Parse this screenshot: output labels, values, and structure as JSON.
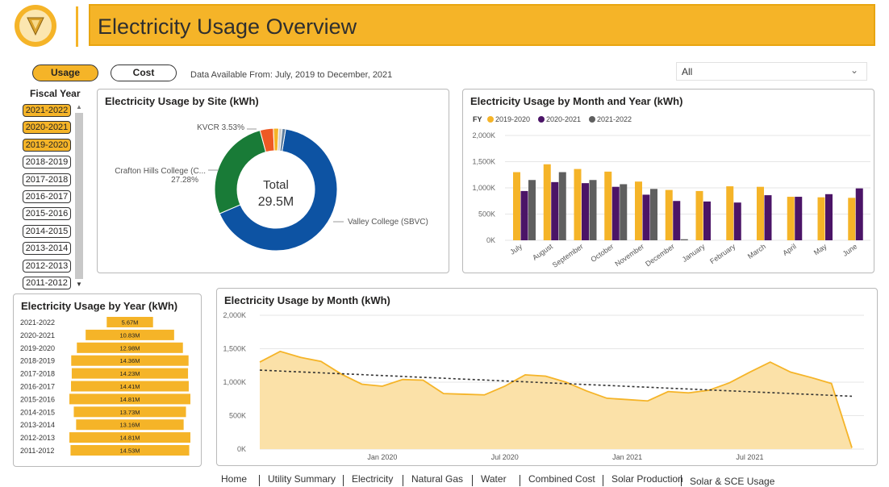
{
  "header": {
    "title": "Electricity Usage Overview"
  },
  "toggles": {
    "usage": "Usage",
    "cost": "Cost"
  },
  "availability": "Data Available From: July, 2019 to December, 2021",
  "site_filter": {
    "value": "All"
  },
  "fiscal_year": {
    "title": "Fiscal Year",
    "items": [
      {
        "label": "2021-2022",
        "selected": true
      },
      {
        "label": "2020-2021",
        "selected": true
      },
      {
        "label": "2019-2020",
        "selected": true
      },
      {
        "label": "2018-2019",
        "selected": false
      },
      {
        "label": "2017-2018",
        "selected": false
      },
      {
        "label": "2016-2017",
        "selected": false
      },
      {
        "label": "2015-2016",
        "selected": false
      },
      {
        "label": "2014-2015",
        "selected": false
      },
      {
        "label": "2013-2014",
        "selected": false
      },
      {
        "label": "2012-2013",
        "selected": false
      },
      {
        "label": "2011-2012",
        "selected": false
      }
    ]
  },
  "colors": {
    "accent": "#f5b428",
    "y2020_2021": "#4b1467",
    "y2021_2022": "#5f5f5f",
    "valley": "#0d53a3",
    "crafton": "#197b37",
    "kvcr": "#ee5a24"
  },
  "nav": [
    "Home",
    "Utility Summary",
    "Electricity",
    "Natural Gas",
    "Water",
    "Combined Cost",
    "Solar Production",
    "Solar & SCE Usage"
  ],
  "chart_data": [
    {
      "type": "pie",
      "title": "Electricity Usage by Site (kWh)",
      "center_label": "Total",
      "center_value": "29.5M",
      "slices": [
        {
          "name": "Valley College (SBVC)",
          "value": 66.0,
          "color": "#0d53a3",
          "label": "Valley College (SBVC)"
        },
        {
          "name": "Crafton Hills College",
          "value": 27.28,
          "color": "#197b37",
          "label": "Crafton Hills College (C...",
          "sublabel": "27.28%"
        },
        {
          "name": "KVCR",
          "value": 3.53,
          "color": "#ee5a24",
          "label": "KVCR 3.53%"
        },
        {
          "name": "other-1",
          "value": 1.4,
          "color": "#f5b428"
        },
        {
          "name": "other-2",
          "value": 0.9,
          "color": "#cfcfcf"
        },
        {
          "name": "other-3",
          "value": 0.9,
          "color": "#5f7fa0"
        }
      ]
    },
    {
      "type": "bar",
      "title": "Electricity Usage by Month and Year (kWh)",
      "legend_title": "FY",
      "categories": [
        "July",
        "August",
        "September",
        "October",
        "November",
        "December",
        "January",
        "February",
        "March",
        "April",
        "May",
        "June"
      ],
      "series": [
        {
          "name": "2019-2020",
          "color": "#f5b428",
          "values": [
            1300000,
            1450000,
            1360000,
            1310000,
            1120000,
            960000,
            940000,
            1030000,
            1020000,
            830000,
            820000,
            810000
          ]
        },
        {
          "name": "2020-2021",
          "color": "#4b1467",
          "values": [
            940000,
            1110000,
            1090000,
            1020000,
            870000,
            750000,
            740000,
            720000,
            860000,
            830000,
            880000,
            990000
          ]
        },
        {
          "name": "2021-2022",
          "color": "#5f5f5f",
          "values": [
            1150000,
            1300000,
            1150000,
            1070000,
            980000,
            20000,
            null,
            null,
            null,
            null,
            null,
            null
          ]
        }
      ],
      "ylim": [
        0,
        2000000
      ],
      "yticks": [
        "0K",
        "500K",
        "1,000K",
        "1,500K",
        "2,000K"
      ],
      "legend_position": "top-left"
    },
    {
      "type": "bar",
      "title": "Electricity Usage by Year (kWh)",
      "categories": [
        "2021-2022",
        "2020-2021",
        "2019-2020",
        "2018-2019",
        "2017-2018",
        "2016-2017",
        "2015-2016",
        "2014-2015",
        "2013-2014",
        "2012-2013",
        "2011-2012"
      ],
      "values": [
        5.67,
        10.83,
        12.98,
        14.36,
        14.23,
        14.41,
        14.81,
        13.73,
        13.16,
        14.81,
        14.53
      ],
      "data_labels": [
        "5.67M",
        "10.83M",
        "12.98M",
        "14.36M",
        "14.23M",
        "14.41M",
        "14.81M",
        "13.73M",
        "13.16M",
        "14.81M",
        "14.53M"
      ],
      "orientation": "horizontal-centered"
    },
    {
      "type": "area",
      "title": "Electricity Usage by Month (kWh)",
      "x": [
        "Jul 2019",
        "Aug 2019",
        "Sep 2019",
        "Oct 2019",
        "Nov 2019",
        "Dec 2019",
        "Jan 2020",
        "Feb 2020",
        "Mar 2020",
        "Apr 2020",
        "May 2020",
        "Jun 2020",
        "Jul 2020",
        "Aug 2020",
        "Sep 2020",
        "Oct 2020",
        "Nov 2020",
        "Dec 2020",
        "Jan 2021",
        "Feb 2021",
        "Mar 2021",
        "Apr 2021",
        "May 2021",
        "Jun 2021",
        "Jul 2021",
        "Aug 2021",
        "Sep 2021",
        "Oct 2021",
        "Nov 2021",
        "Dec 2021"
      ],
      "values": [
        1300000,
        1460000,
        1370000,
        1310000,
        1120000,
        970000,
        940000,
        1040000,
        1030000,
        830000,
        820000,
        810000,
        940000,
        1110000,
        1090000,
        1000000,
        870000,
        760000,
        740000,
        720000,
        860000,
        840000,
        880000,
        990000,
        1150000,
        1300000,
        1150000,
        1070000,
        980000,
        20000
      ],
      "trend": [
        1180000,
        790000
      ],
      "xticks": [
        "Jan 2020",
        "Jul 2020",
        "Jan 2021",
        "Jul 2021"
      ],
      "ylim": [
        0,
        2000000
      ],
      "yticks": [
        "0K",
        "500K",
        "1,000K",
        "1,500K",
        "2,000K"
      ]
    }
  ]
}
